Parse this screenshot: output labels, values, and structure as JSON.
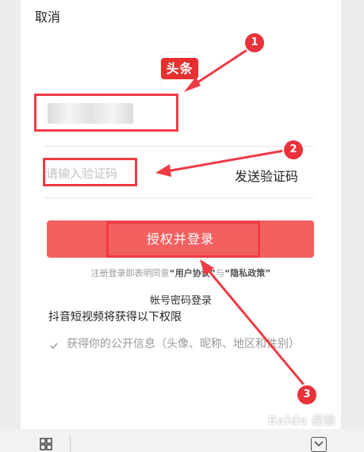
{
  "header": {
    "cancel_label": "取消"
  },
  "app": {
    "logo_text": "头条",
    "brand_color": "#e5302f"
  },
  "login": {
    "code_placeholder": "请输入验证码",
    "send_code_label": "发送验证码",
    "submit_label": "授权并登录",
    "agreement": {
      "prefix": "注册登录即表明同意",
      "user_agreement": "“用户协议”",
      "joiner": "与",
      "privacy_policy": "“隐私政策”"
    },
    "account_login_label": "帐号密码登录"
  },
  "permissions": {
    "title": "抖音短视频将获得以下权限",
    "items": [
      "获得你的公开信息（头像、昵称、地区和性别）"
    ]
  },
  "annotations": {
    "markers": [
      "1",
      "2",
      "3"
    ],
    "color": "#ef3b45"
  },
  "watermark": {
    "text": "Baidu 经验"
  }
}
